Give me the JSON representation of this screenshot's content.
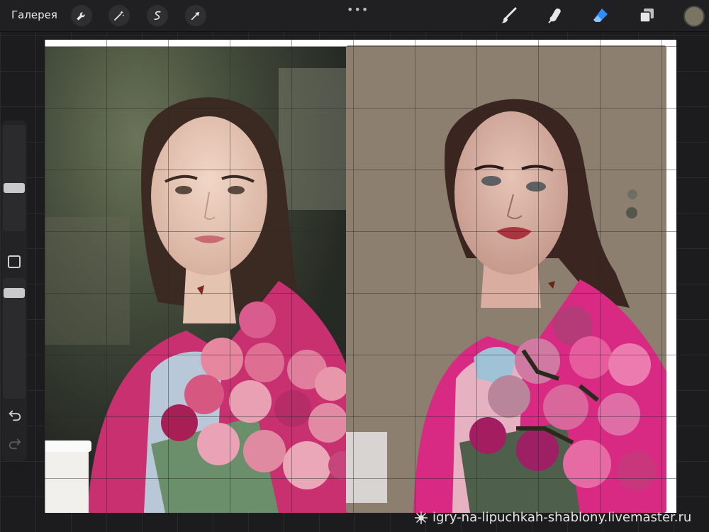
{
  "topbar": {
    "gallery_label": "Галерея",
    "more_icon": "•••",
    "left_tools": [
      "wrench-icon",
      "magic-wand-icon",
      "selection-icon",
      "transform-arrow-icon"
    ],
    "right_tools": [
      "brush-icon",
      "smudge-icon",
      "eraser-icon",
      "layers-icon"
    ],
    "active_tool": "eraser-icon",
    "active_color": "#7a7563",
    "accent": "#2f8cff"
  },
  "sidebar": {
    "tools": [
      "brush-size-slider",
      "modify-button",
      "opacity-slider",
      "undo-icon",
      "redo-icon"
    ]
  },
  "canvas": {
    "left_image": "reference-photo",
    "right_image": "painting-in-progress",
    "palette_colors": [
      "#6d6f65",
      "#55574f"
    ]
  },
  "watermark": {
    "text": "igry-na-lipuchkah-shablony.livemaster.ru"
  }
}
